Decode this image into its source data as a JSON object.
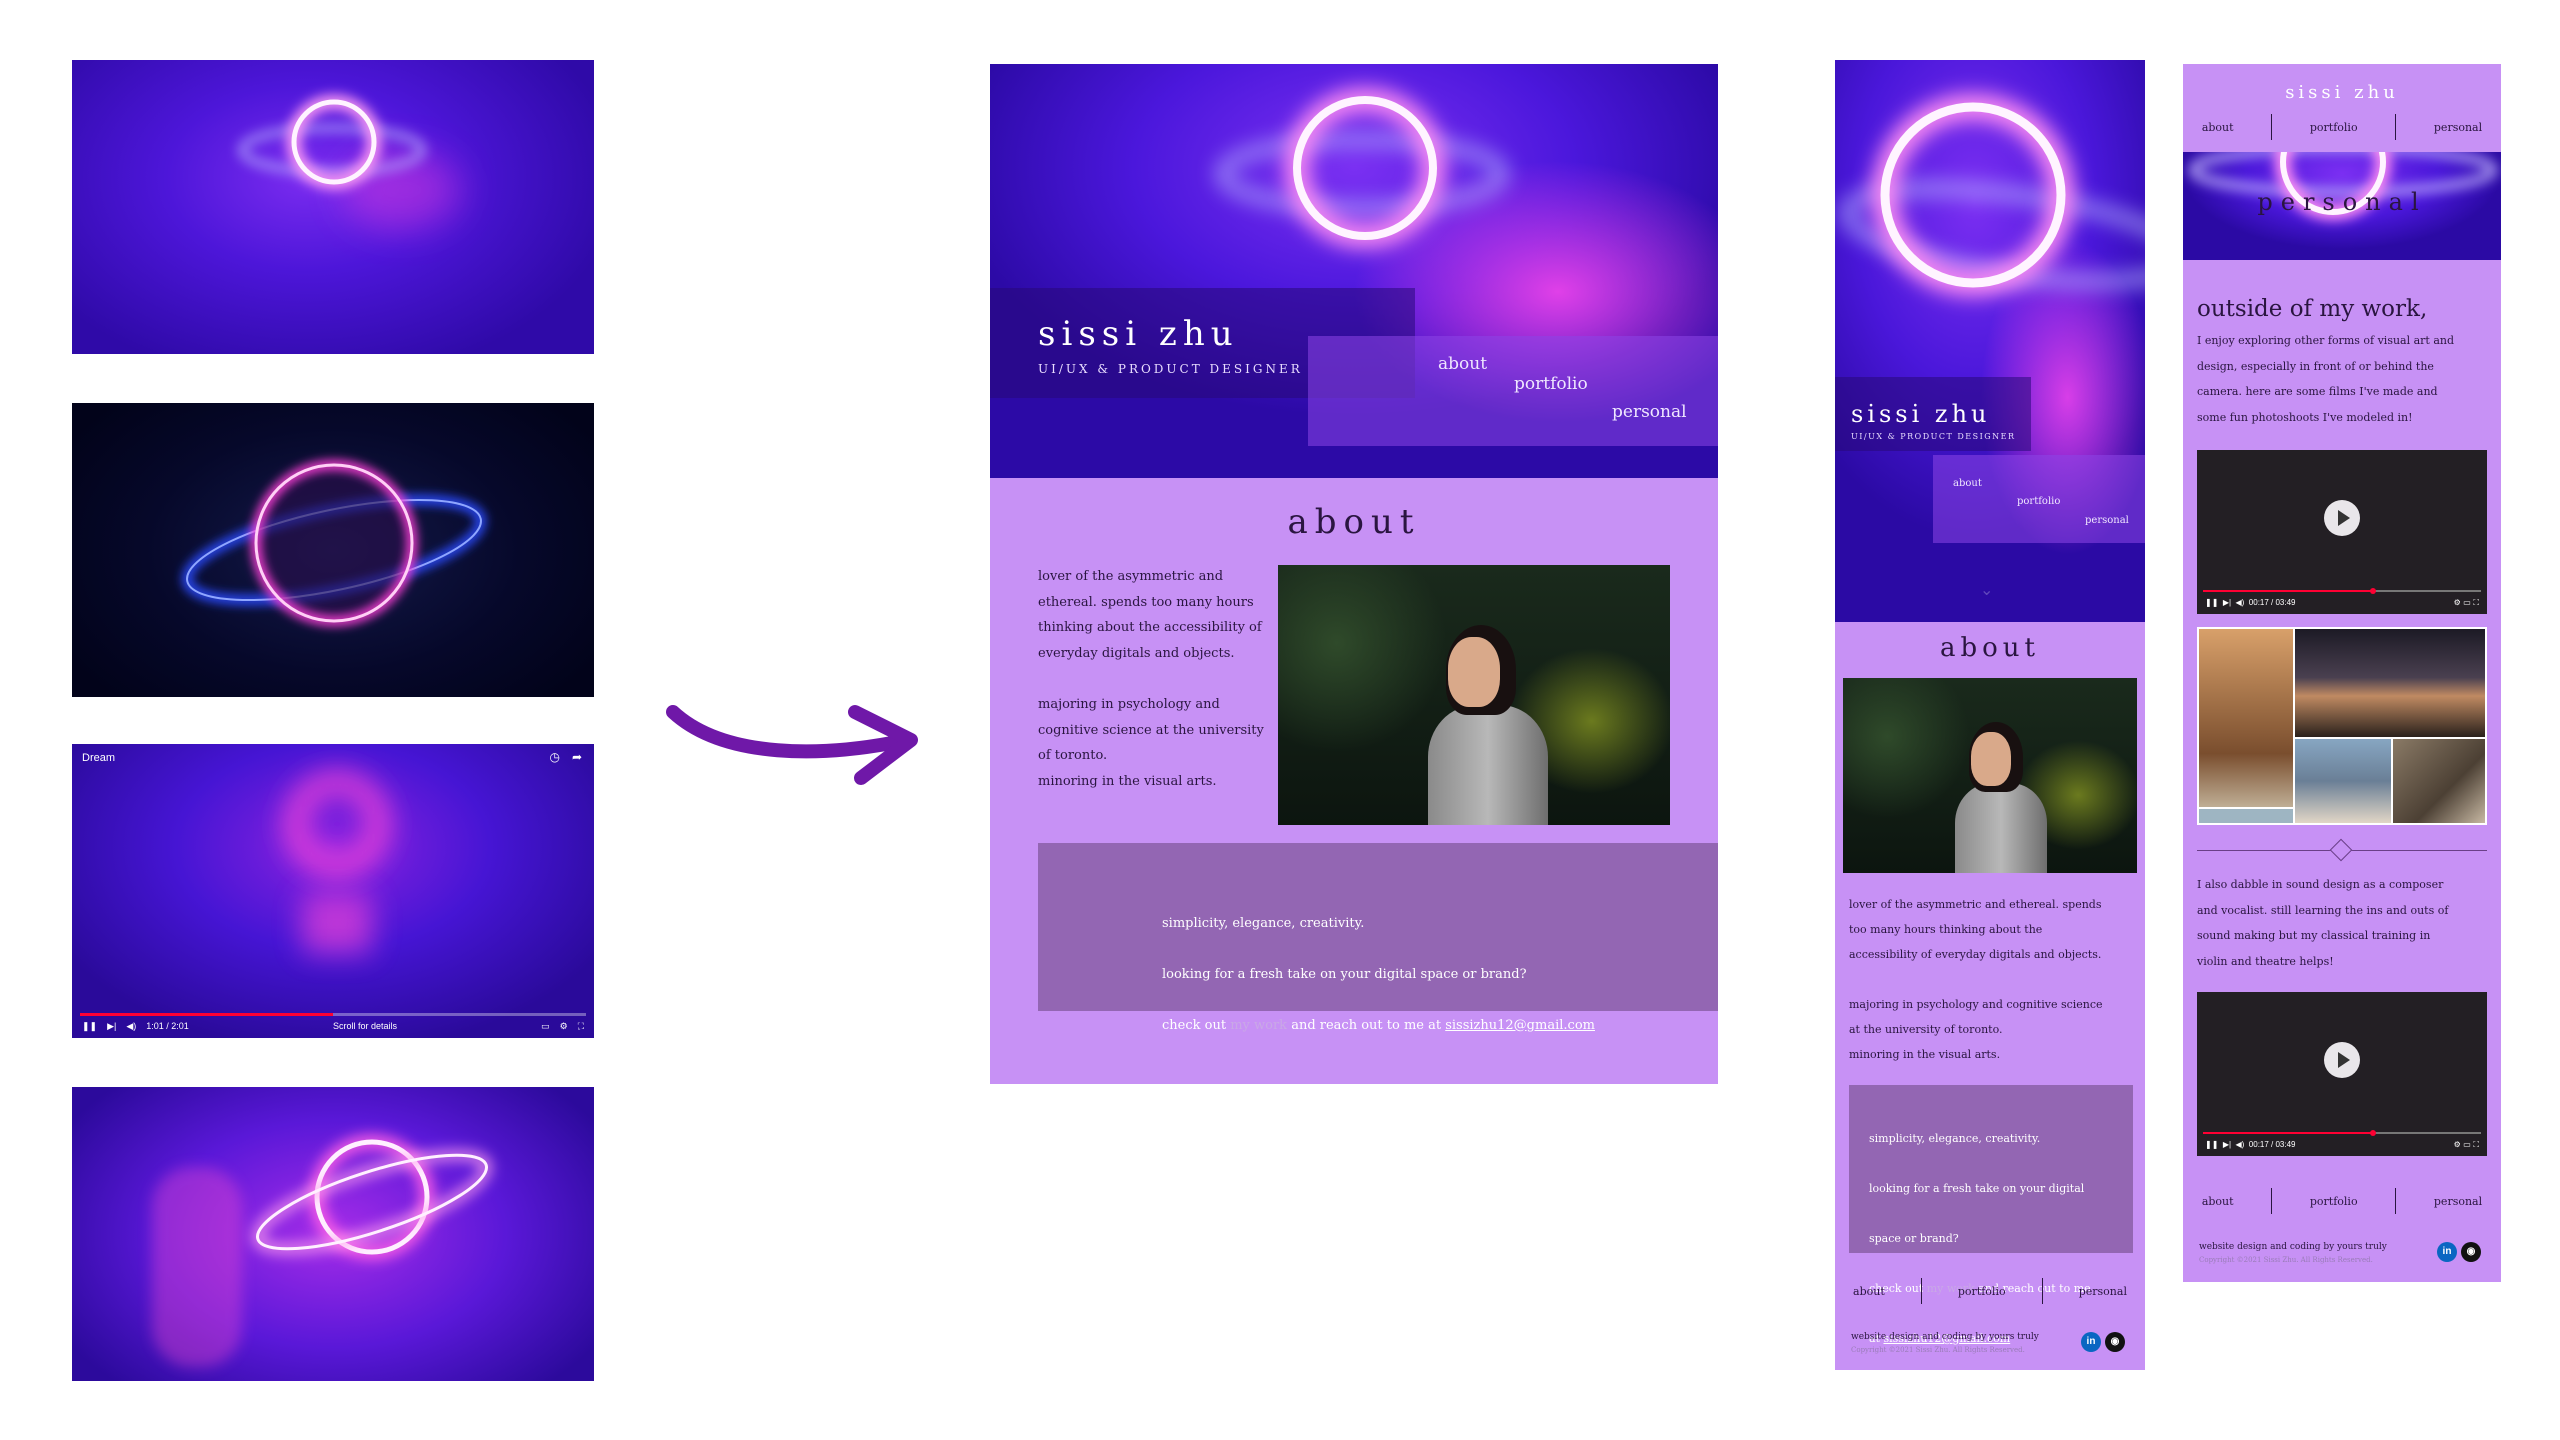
{
  "thumbnails": {
    "video": {
      "title": "Dream",
      "time": "1:01 / 2:01",
      "hint": "Scroll for details",
      "progress": 0.5
    }
  },
  "desktop": {
    "hero": {
      "name": "sissi zhu",
      "subtitle": "UI/UX & product designer",
      "nav": [
        "about",
        "portfolio",
        "personal"
      ]
    },
    "about": {
      "title": "about",
      "para1": "lover of the asymmetric and\nethereal. spends too many hours\nthinking about the accessibility of\neveryday digitals and objects.",
      "para2": "majoring in psychology and\ncognitive science at the university\nof toronto.\nminoring in the visual arts."
    },
    "cta": {
      "line1": "simplicity, elegance, creativity.",
      "line2": "looking for a fresh take on your digital space or brand?",
      "check_prefix": "check out ",
      "link": "my work",
      "middle": " and reach out to me at ",
      "email": "sissizhu12@gmail.com"
    }
  },
  "mobile_about": {
    "hero": {
      "name": "sissi zhu",
      "subtitle": "UI/UX & product designer",
      "nav": [
        "about",
        "portfolio",
        "personal"
      ]
    },
    "about_title": "about",
    "para1": "lover of the asymmetric and ethereal. spends\ntoo many hours thinking about the\naccessibility of everyday digitals and objects.",
    "para2": "majoring in psychology and cognitive science\nat the university of toronto.\nminoring in the visual arts.",
    "cta": {
      "line1": "simplicity, elegance, creativity.",
      "line2": "looking for a fresh take on your digital",
      "line3": "space or brand?",
      "check_prefix": "check out ",
      "link": "my work",
      "middle": " and reach out to me",
      "at": "at ",
      "email": "sissizhu12@gmail.com"
    },
    "footer_nav": [
      "about",
      "portfolio",
      "personal"
    ],
    "footer_note": "website design and coding by yours truly",
    "footer_copy": "Copyright ©2021 Sissi Zhu. All Rights Reserved.",
    "icons": [
      "linkedin-icon",
      "github-icon"
    ]
  },
  "mobile_personal": {
    "brand": "sissi zhu",
    "nav": [
      "about",
      "portfolio",
      "personal"
    ],
    "banner_title": "personal",
    "heading": "outside of my work,",
    "para1": "I enjoy exploring other forms of visual art and\ndesign, especially in front of or behind the\ncamera. here are some films I've made and\nsome fun photoshoots I've modeled in!",
    "video1_time": "00:17 / 03:49",
    "para2": "I also dabble in sound design as a composer\nand vocalist. still learning the ins and outs of\nsound making but my classical training in\nviolin and theatre helps!",
    "video2_time": "00:17 / 03:49",
    "footer_nav": [
      "about",
      "portfolio",
      "personal"
    ],
    "footer_note": "website design and coding by yours truly",
    "footer_copy": "Copyright ©2021 Sissi Zhu. All Rights Reserved.",
    "icons": [
      "linkedin-icon",
      "github-icon"
    ]
  },
  "colors": {
    "lavender": "#c791f5",
    "deep_purple": "#4b17dc",
    "cta_box": "#9366b3",
    "arrow": "#6f18a8"
  }
}
